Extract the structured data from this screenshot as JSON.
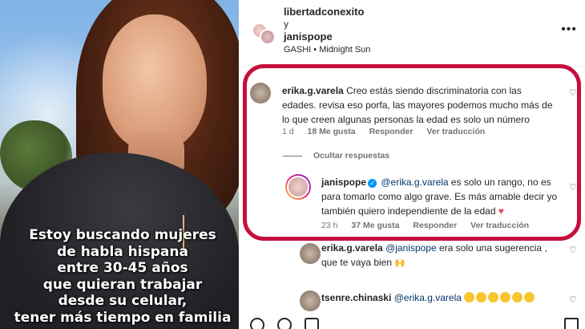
{
  "post": {
    "caption_lines": [
      "Estoy buscando mujeres",
      "de habla hispana",
      "entre 30-45 años",
      "que quieran trabajar",
      "desde su celular,",
      "tener más tiempo en familia"
    ]
  },
  "header": {
    "user1": "libertadconexito",
    "and": "y",
    "user2": "janispope",
    "song": "GASHI • Midnight Sun",
    "more_icon": "ellipsis-icon"
  },
  "comments": [
    {
      "username": "erika.g.varela",
      "text": "Creo estás siendo discriminatoria con las edades. revisa eso porfa, las mayores podemos mucho más de lo que creen algunas personas la edad es solo un número",
      "time": "1 d",
      "likes": "18 Me gusta",
      "reply": "Responder",
      "translate": "Ver traducción"
    }
  ],
  "hide_replies": "Ocultar respuestas",
  "reply": {
    "username": "janispope",
    "mention": "@erika.g.varela",
    "text": " es solo un rango, no es para tomarlo como algo grave. Es más amable decir yo también quiero independiente de la edad",
    "time": "23 h",
    "likes": "37 Me gusta",
    "reply": "Responder",
    "translate": "Ver traducción"
  },
  "reply2": {
    "username": "erika.g.varela",
    "mention": "@janispope",
    "text": " era solo una sugerencia , que te vaya bien"
  },
  "reply3": {
    "username": "tsenre.chinaski",
    "mention": "@erika.g.varela"
  },
  "colors": {
    "highlight": "#c40f3c",
    "mention": "#00376b",
    "verified": "#0095f6"
  }
}
